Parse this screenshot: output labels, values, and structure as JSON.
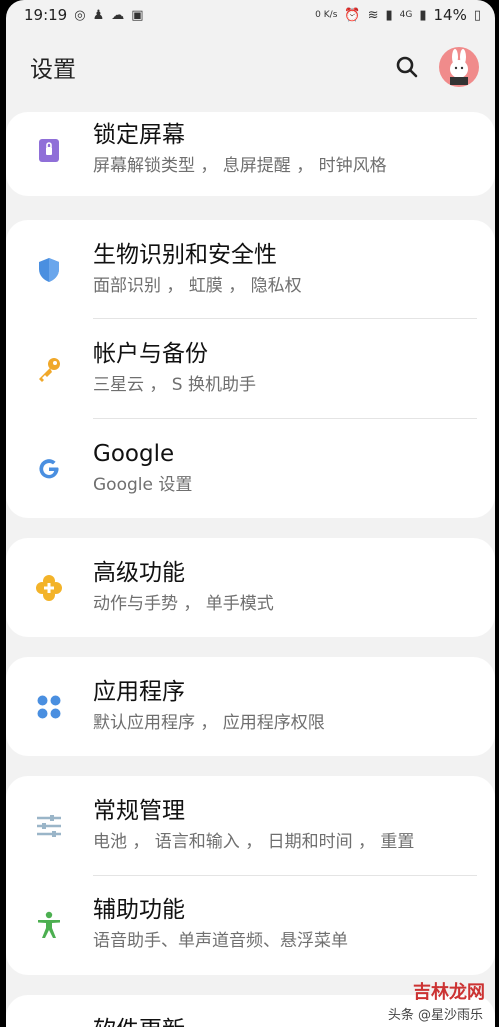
{
  "status_bar": {
    "time": "19:19",
    "speed": "0 K/s",
    "network": "4G",
    "battery": "14%"
  },
  "header": {
    "title": "设置"
  },
  "items": [
    {
      "title": "锁定屏幕",
      "subtitle": "屏幕解锁类型 ， 息屏提醒 ， 时钟风格",
      "icon": "lock-icon",
      "color": "#8f6fd8"
    },
    {
      "title": "生物识别和安全性",
      "subtitle": "面部识别 ， 虹膜 ， 隐私权",
      "icon": "shield-icon",
      "color": "#4a8fe0"
    },
    {
      "title": "帐户与备份",
      "subtitle": "三星云 ， S 换机助手",
      "icon": "key-icon",
      "color": "#f0a82a"
    },
    {
      "title": "Google",
      "subtitle": "Google 设置",
      "icon": "google-icon",
      "color": "#4a8fe0"
    },
    {
      "title": "高级功能",
      "subtitle": "动作与手势 ， 单手模式",
      "icon": "gear-flower-icon",
      "color": "#f3b329"
    },
    {
      "title": "应用程序",
      "subtitle": "默认应用程序 ， 应用程序权限",
      "icon": "apps-icon",
      "color": "#4a8fe0"
    },
    {
      "title": "常规管理",
      "subtitle": "电池 ， 语言和输入 ， 日期和时间 ， 重置",
      "icon": "sliders-icon",
      "color": "#9ab5c8"
    },
    {
      "title": "辅助功能",
      "subtitle": "语音助手、单声道音频、悬浮菜单",
      "icon": "accessibility-icon",
      "color": "#4caf50"
    },
    {
      "title": "软件更新",
      "subtitle": "",
      "icon": "update-icon",
      "color": "#4a8fe0"
    }
  ],
  "watermark": {
    "text": "吉林龙网",
    "sub": "头条 @星沙雨乐"
  }
}
